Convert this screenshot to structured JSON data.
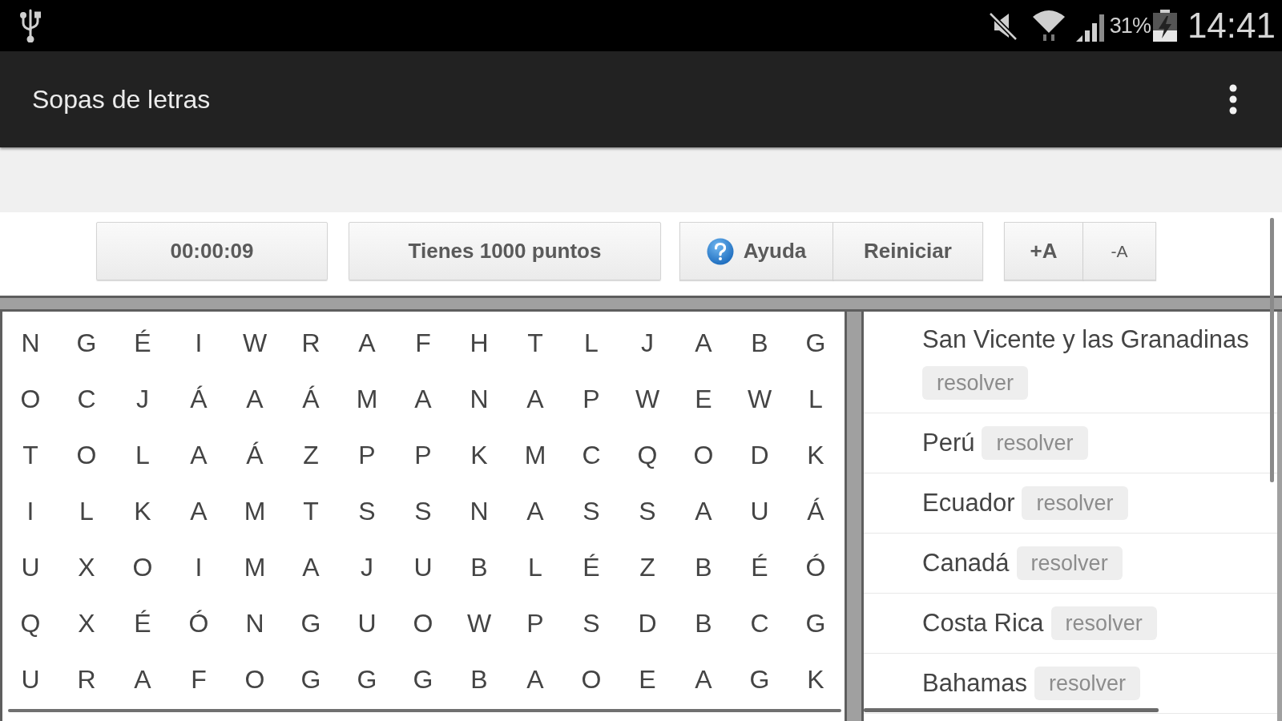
{
  "status_bar": {
    "battery": "31%",
    "time": "14:41"
  },
  "app_bar": {
    "title": "Sopas de letras"
  },
  "toolbar": {
    "timer": "00:00:09",
    "score": "Tienes 1000 puntos",
    "actions": [
      {
        "kind": "help",
        "label": "Ayuda"
      },
      {
        "kind": "restart",
        "label": "Reiniciar"
      }
    ],
    "font_size": [
      {
        "kind": "increase",
        "label": "+A"
      },
      {
        "kind": "decrease",
        "label": "-A"
      }
    ]
  },
  "letter_grid": [
    [
      "N",
      "G",
      "É",
      "I",
      "W",
      "R",
      "A",
      "F",
      "H",
      "T",
      "L",
      "J",
      "A",
      "B",
      "G"
    ],
    [
      "O",
      "C",
      "J",
      "Á",
      "A",
      "Á",
      "M",
      "A",
      "N",
      "A",
      "P",
      "W",
      "E",
      "W",
      "L"
    ],
    [
      "T",
      "O",
      "L",
      "A",
      "Á",
      "Z",
      "P",
      "P",
      "K",
      "M",
      "C",
      "Q",
      "O",
      "D",
      "K"
    ],
    [
      "I",
      "L",
      "K",
      "A",
      "M",
      "T",
      "S",
      "S",
      "N",
      "A",
      "S",
      "S",
      "A",
      "U",
      "Á"
    ],
    [
      "U",
      "X",
      "O",
      "I",
      "M",
      "A",
      "J",
      "U",
      "B",
      "L",
      "É",
      "Z",
      "B",
      "É",
      "Ó"
    ],
    [
      "Q",
      "X",
      "É",
      "Ó",
      "N",
      "G",
      "U",
      "O",
      "W",
      "P",
      "S",
      "D",
      "B",
      "C",
      "G"
    ],
    [
      "U",
      "R",
      "A",
      "F",
      "O",
      "G",
      "G",
      "G",
      "B",
      "A",
      "O",
      "E",
      "A",
      "G",
      "K"
    ]
  ],
  "word_list": [
    {
      "word": "San Vicente y las Granadinas",
      "button": "resolver"
    },
    {
      "word": "Perú",
      "button": "resolver"
    },
    {
      "word": "Ecuador",
      "button": "resolver"
    },
    {
      "word": "Canadá",
      "button": "resolver"
    },
    {
      "word": "Costa Rica",
      "button": "resolver"
    },
    {
      "word": "Bahamas",
      "button": "resolver"
    }
  ]
}
